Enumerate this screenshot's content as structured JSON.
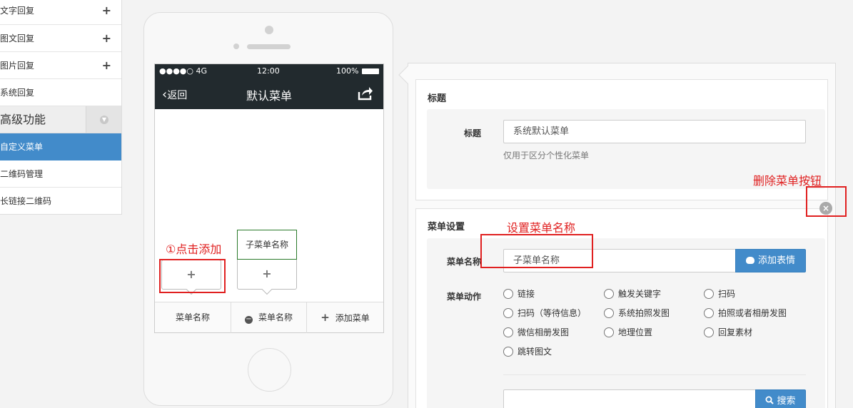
{
  "sidebar": {
    "items_top": [
      {
        "label": "文字回复",
        "plus": "+"
      },
      {
        "label": "图文回复",
        "plus": "+"
      },
      {
        "label": "图片回复",
        "plus": "+"
      },
      {
        "label": "系统回复"
      }
    ],
    "group": {
      "label": "高级功能",
      "icon": "chevron-down-icon"
    },
    "items_bottom": [
      {
        "label": "自定义菜单",
        "active": true
      },
      {
        "label": "二维码管理"
      },
      {
        "label": "长链接二维码"
      }
    ]
  },
  "phone": {
    "status": {
      "signal": "●●●●○ 4G",
      "time": "12:00",
      "battery": "100%"
    },
    "nav": {
      "back_label": "返回",
      "title": "默认菜单",
      "share_icon": "share-icon"
    },
    "submenu": {
      "add_plus": "+",
      "sub_name": "子菜单名称",
      "sub_plus": "+"
    },
    "menubar": {
      "item1": "菜单名称",
      "item2": "菜单名称",
      "item2_icon": "minus-circle-icon",
      "add_label": "添加菜单",
      "add_plus": "+"
    }
  },
  "annotations": {
    "click_add": "①点击添加",
    "set_name": "设置菜单名称",
    "delete_btn": "删除菜单按钮"
  },
  "form": {
    "title_section": {
      "heading": "标题",
      "label": "标题",
      "value": "系统默认菜单",
      "help": "仅用于区分个性化菜单"
    },
    "menu_section": {
      "heading": "菜单设置",
      "name_label": "菜单名称",
      "name_value": "子菜单名称",
      "emoji_button": "添加表情",
      "action_label": "菜单动作",
      "actions": [
        "链接",
        "触发关键字",
        "扫码",
        "扫码（等待信息）",
        "系统拍照发图",
        "拍照或者相册发图",
        "微信相册发图",
        "地理位置",
        "回复素材",
        "跳转图文"
      ],
      "search_value": "",
      "search_button": "搜索",
      "delete_icon": "close-circle-icon"
    }
  },
  "colors": {
    "accent": "#428bca",
    "annotation": "#e02020",
    "navbar": "#222a2e"
  }
}
